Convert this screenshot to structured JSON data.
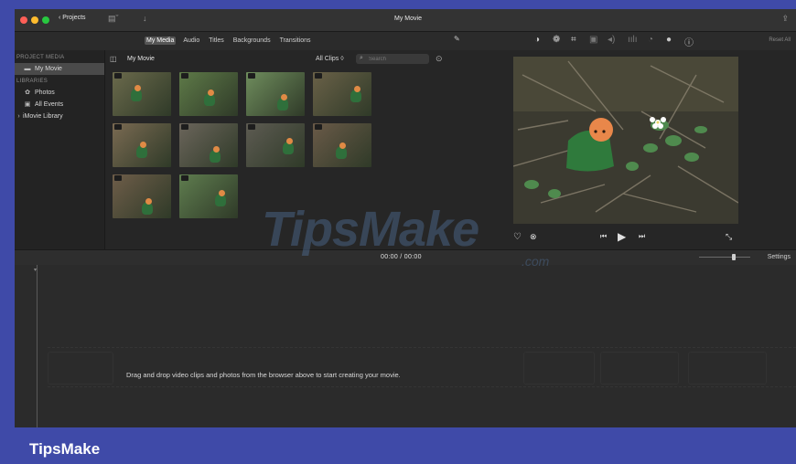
{
  "titlebar": {
    "projects_label": "‹ Projects",
    "title": "My Movie"
  },
  "toolbar": {
    "tabs": [
      {
        "label": "My Media",
        "active": true
      },
      {
        "label": "Audio",
        "active": false
      },
      {
        "label": "Titles",
        "active": false
      },
      {
        "label": "Backgrounds",
        "active": false
      },
      {
        "label": "Transitions",
        "active": false
      }
    ],
    "tools": [
      "color-balance-icon",
      "color-correction-icon",
      "crop-icon",
      "stabilization-icon",
      "volume-icon",
      "noise-reduction-icon",
      "speed-icon",
      "clip-filter-icon",
      "info-icon"
    ],
    "reset_all": "Reset All"
  },
  "sidebar": {
    "project_media_header": "PROJECT MEDIA",
    "project_item": "My Movie",
    "libraries_header": "LIBRARIES",
    "library_items": [
      "Photos",
      "All Events",
      "iMovie Library"
    ]
  },
  "browser": {
    "title": "My Movie",
    "filter_label": "All Clips ◊",
    "search_placeholder": "Search",
    "thumbnails": [
      {
        "bg": "#6b6a4c"
      },
      {
        "bg": "#5e7a48"
      },
      {
        "bg": "#6f8d5d"
      },
      {
        "bg": "#6a6148"
      },
      {
        "bg": "#7a6a52"
      },
      {
        "bg": "#6b655b"
      },
      {
        "bg": "#5d5b52"
      },
      {
        "bg": "#6a5a48"
      },
      {
        "bg": "#6e5d49"
      },
      {
        "bg": "#5f7d4f"
      }
    ]
  },
  "viewer": {
    "favorite_icon": "heart-icon",
    "reject_icon": "reject-icon",
    "prev_icon": "skip-back-icon",
    "play_icon": "play-icon",
    "next_icon": "skip-forward-icon",
    "fullscreen_icon": "fullscreen-icon"
  },
  "midbar": {
    "timecode": "00:00 / 00:00",
    "settings_label": "Settings"
  },
  "timeline": {
    "drop_message": "Drag and drop video clips and photos from the browser above to start creating your movie."
  },
  "watermark": {
    "text": "TipsMake",
    "suffix": ".com"
  },
  "footer": {
    "brand": "TipsMake"
  },
  "colors": {
    "frame": "#3f4aa8",
    "app_bg": "#262626",
    "accent_green": "#2f6f3b"
  }
}
